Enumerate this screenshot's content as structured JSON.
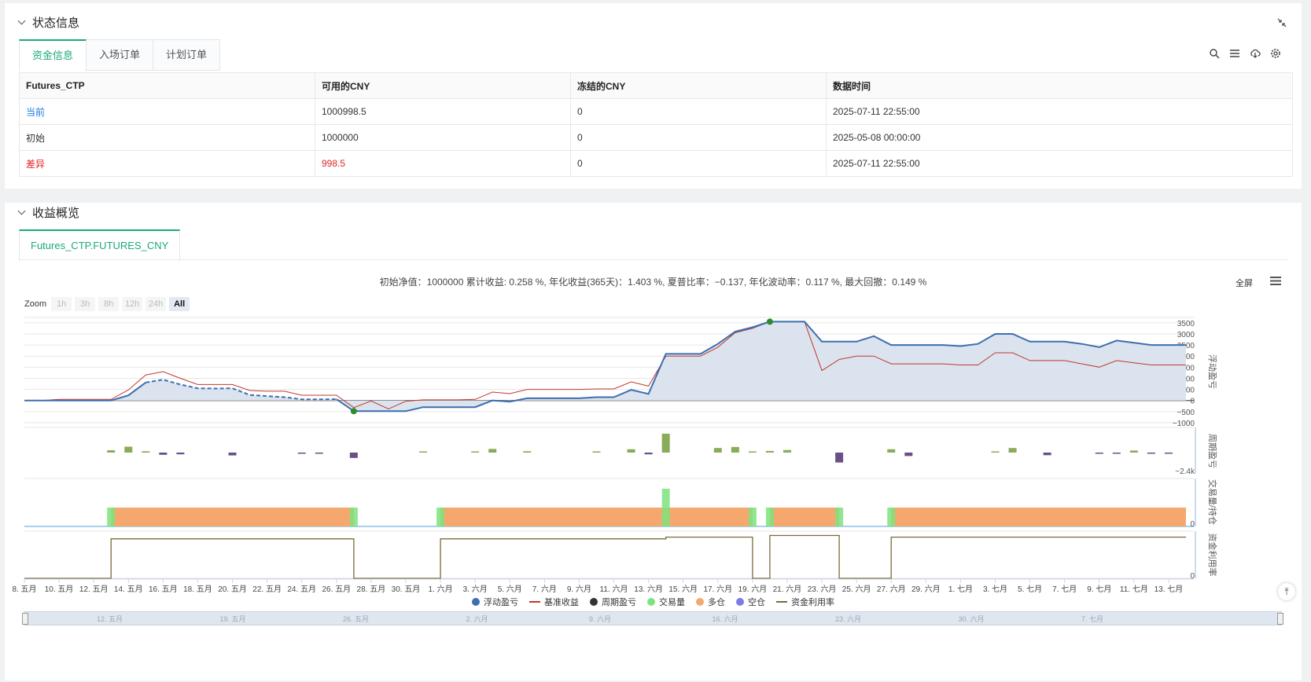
{
  "status_panel": {
    "title": "状态信息",
    "tabs": [
      "资金信息",
      "入场订单",
      "计划订单"
    ],
    "table": {
      "headers": [
        "Futures_CTP",
        "可用的CNY",
        "冻结的CNY",
        "数据时间"
      ],
      "rows": [
        [
          "当前",
          "1000998.5",
          "0",
          "2025-07-11 22:55:00"
        ],
        [
          "初始",
          "1000000",
          "0",
          "2025-05-08 00:00:00"
        ],
        [
          "差异",
          "998.5",
          "0",
          "2025-07-11 22:55:00"
        ]
      ]
    }
  },
  "profit_panel": {
    "title": "收益概览",
    "tab": "Futures_CTP.FUTURES_CNY",
    "stats": "初始净值：1000000 累计收益: 0.258 %, 年化收益(365天)：1.403 %, 夏普比率：−0.137, 年化波动率：0.117 %, 最大回撤：0.149 %",
    "fullscreen": "全屏",
    "zoom_label": "Zoom",
    "zoom_buttons": [
      "1h",
      "3h",
      "8h",
      "12h",
      "24h",
      "All"
    ],
    "legend": [
      "浮动盈亏",
      "基准收益",
      "周期盈亏",
      "交易量",
      "多仓",
      "空仓",
      "资金利用率"
    ],
    "nav_labels": [
      "12. 五月",
      "19. 五月",
      "26. 五月",
      "2. 六月",
      "9. 六月",
      "16. 六月",
      "23. 六月",
      "30. 六月",
      "7. 七月"
    ]
  },
  "chart_data": [
    {
      "type": "area",
      "pane": "浮动盈亏",
      "ylabel": "浮动盈亏",
      "yticks": [
        3500,
        3000,
        2500,
        2000,
        1500,
        1000,
        500,
        0,
        -500,
        -1000
      ],
      "ylim": [
        -1000,
        3600
      ],
      "x": [
        "2025-05-08",
        "2025-05-09",
        "2025-05-10",
        "2025-05-11",
        "2025-05-12",
        "2025-05-13",
        "2025-05-14",
        "2025-05-15",
        "2025-05-16",
        "2025-05-17",
        "2025-05-18",
        "2025-05-19",
        "2025-05-20",
        "2025-05-21",
        "2025-05-22",
        "2025-05-23",
        "2025-05-24",
        "2025-05-25",
        "2025-05-26",
        "2025-05-27",
        "2025-05-28",
        "2025-05-29",
        "2025-05-30",
        "2025-05-31",
        "2025-06-01",
        "2025-06-02",
        "2025-06-03",
        "2025-06-04",
        "2025-06-05",
        "2025-06-06",
        "2025-06-07",
        "2025-06-08",
        "2025-06-09",
        "2025-06-10",
        "2025-06-11",
        "2025-06-12",
        "2025-06-13",
        "2025-06-14",
        "2025-06-15",
        "2025-06-16",
        "2025-06-17",
        "2025-06-18",
        "2025-06-19",
        "2025-06-20",
        "2025-06-21",
        "2025-06-22",
        "2025-06-23",
        "2025-06-24",
        "2025-06-25",
        "2025-06-26",
        "2025-06-27",
        "2025-06-28",
        "2025-06-29",
        "2025-06-30",
        "2025-07-01",
        "2025-07-02",
        "2025-07-03",
        "2025-07-04",
        "2025-07-05",
        "2025-07-06",
        "2025-07-07",
        "2025-07-08",
        "2025-07-09",
        "2025-07-10",
        "2025-07-11",
        "2025-07-12",
        "2025-07-13",
        "2025-07-14"
      ],
      "series": [
        {
          "name": "浮动盈亏",
          "color": "#3d6eb0",
          "values": [
            0,
            0,
            0,
            0,
            0,
            0,
            230,
            810,
            940,
            720,
            550,
            540,
            550,
            250,
            200,
            150,
            50,
            50,
            60,
            -480,
            -480,
            -480,
            -480,
            -300,
            -300,
            -300,
            -300,
            0,
            -50,
            100,
            100,
            100,
            100,
            150,
            150,
            480,
            300,
            2100,
            2100,
            2100,
            2550,
            3100,
            3300,
            3550,
            3550,
            3550,
            2650,
            2650,
            2650,
            2900,
            2500,
            2500,
            2500,
            2500,
            2450,
            2550,
            3000,
            3000,
            2650,
            2650,
            2650,
            2550,
            2400,
            2700,
            2600,
            2500,
            2500,
            2500
          ]
        },
        {
          "name": "基准收益",
          "color": "#c0392b",
          "values": [
            0,
            0,
            50,
            50,
            50,
            50,
            480,
            1150,
            1300,
            1000,
            720,
            720,
            720,
            450,
            420,
            420,
            240,
            240,
            240,
            -320,
            -20,
            -380,
            -30,
            30,
            30,
            30,
            50,
            380,
            310,
            500,
            500,
            500,
            500,
            520,
            520,
            840,
            650,
            2000,
            2000,
            2000,
            2400,
            3050,
            3250,
            3550,
            3550,
            3550,
            1350,
            1850,
            2000,
            2000,
            1650,
            1650,
            1650,
            1650,
            1600,
            1600,
            2150,
            2150,
            1800,
            1800,
            1800,
            1650,
            1500,
            1800,
            1700,
            1600,
            1600,
            1600
          ]
        }
      ],
      "markers": [
        {
          "x": "2025-05-27",
          "y": -480,
          "color": "#2e8b2e"
        },
        {
          "x": "2025-06-20",
          "y": 3550,
          "color": "#2e8b2e"
        }
      ]
    },
    {
      "type": "bar",
      "pane": "周期盈亏",
      "ylabel": "周期盈亏",
      "yticks": [
        -2400
      ],
      "ytick_labels": [
        "−2.4k"
      ],
      "ylim": [
        -2400,
        2400
      ],
      "x": [
        "2025-05-13",
        "2025-05-14",
        "2025-05-15",
        "2025-05-16",
        "2025-05-17",
        "2025-05-20",
        "2025-05-24",
        "2025-05-25",
        "2025-05-27",
        "2025-05-31",
        "2025-06-03",
        "2025-06-04",
        "2025-06-06",
        "2025-06-10",
        "2025-06-12",
        "2025-06-13",
        "2025-06-14",
        "2025-06-17",
        "2025-06-18",
        "2025-06-19",
        "2025-06-20",
        "2025-06-21",
        "2025-06-24",
        "2025-06-27",
        "2025-06-28",
        "2025-07-03",
        "2025-07-04",
        "2025-07-06",
        "2025-07-09",
        "2025-07-10",
        "2025-07-11",
        "2025-07-12",
        "2025-07-13"
      ],
      "values": [
        230,
        580,
        130,
        -220,
        -170,
        -280,
        -50,
        -40,
        -530,
        80,
        60,
        360,
        130,
        40,
        330,
        -170,
        1860,
        450,
        550,
        90,
        160,
        250,
        -980,
        330,
        -340,
        80,
        450,
        -260,
        -60,
        -80,
        200,
        -70,
        -60
      ]
    },
    {
      "type": "bar",
      "pane": "交易量/持仓",
      "ylabel": "交易量/持仓",
      "yticks": [
        0
      ],
      "ylim": [
        0,
        2
      ],
      "volume_spikes": [
        {
          "x": "2025-05-13",
          "value": 1
        },
        {
          "x": "2025-05-27",
          "value": 1
        },
        {
          "x": "2025-06-01",
          "value": 1
        },
        {
          "x": "2025-06-14",
          "value": 2
        },
        {
          "x": "2025-06-19",
          "value": 1
        },
        {
          "x": "2025-06-20",
          "value": 1
        },
        {
          "x": "2025-06-24",
          "value": 1
        },
        {
          "x": "2025-06-27",
          "value": 1
        }
      ],
      "long_positions": [
        {
          "start": "2025-05-13",
          "end": "2025-05-27",
          "value": 1
        },
        {
          "start": "2025-06-01",
          "end": "2025-06-19",
          "value": 1
        },
        {
          "start": "2025-06-20",
          "end": "2025-06-24",
          "value": 1
        },
        {
          "start": "2025-06-27",
          "end": "2025-07-14",
          "value": 1
        }
      ]
    },
    {
      "type": "line",
      "pane": "资金利用率",
      "ylabel": "资金利用率",
      "yticks": [
        0
      ],
      "ylim": [
        0,
        1.1
      ],
      "x": [
        "2025-05-08",
        "2025-05-13",
        "2025-05-13",
        "2025-05-27",
        "2025-05-27",
        "2025-06-01",
        "2025-06-01",
        "2025-06-14",
        "2025-06-14",
        "2025-06-19",
        "2025-06-19",
        "2025-06-20",
        "2025-06-20",
        "2025-06-24",
        "2025-06-24",
        "2025-06-27",
        "2025-06-27",
        "2025-07-14"
      ],
      "values": [
        0,
        0,
        0.92,
        0.92,
        0,
        0,
        0.92,
        0.92,
        0.96,
        0.96,
        0,
        0,
        1.0,
        1.0,
        0,
        0,
        0.96,
        0.96
      ]
    }
  ],
  "xaxis_labels": [
    "8. 五月",
    "10. 五月",
    "12. 五月",
    "14. 五月",
    "16. 五月",
    "18. 五月",
    "20. 五月",
    "22. 五月",
    "24. 五月",
    "26. 五月",
    "28. 五月",
    "30. 五月",
    "1. 六月",
    "3. 六月",
    "5. 六月",
    "7. 六月",
    "9. 六月",
    "11. 六月",
    "13. 六月",
    "15. 六月",
    "17. 六月",
    "19. 六月",
    "21. 六月",
    "23. 六月",
    "25. 六月",
    "27. 六月",
    "29. 六月",
    "1. 七月",
    "3. 七月",
    "5. 七月",
    "7. 七月",
    "9. 七月",
    "11. 七月",
    "13. 七月"
  ],
  "colors": {
    "accent": "#1aa97c",
    "float_pl": "#3d6eb0",
    "benchmark": "#c0392b",
    "period_pl": "#333333",
    "period_pos": "#8aab57",
    "period_neg": "#6b5088",
    "volume": "#7ee37e",
    "long": "#f5a86e",
    "short": "#7b7be8",
    "utilization": "#7a6a3a"
  },
  "icons": [
    "search-icon",
    "list-icon",
    "cloud-download-icon",
    "gear-icon",
    "collapse-icon",
    "menu-icon"
  ]
}
